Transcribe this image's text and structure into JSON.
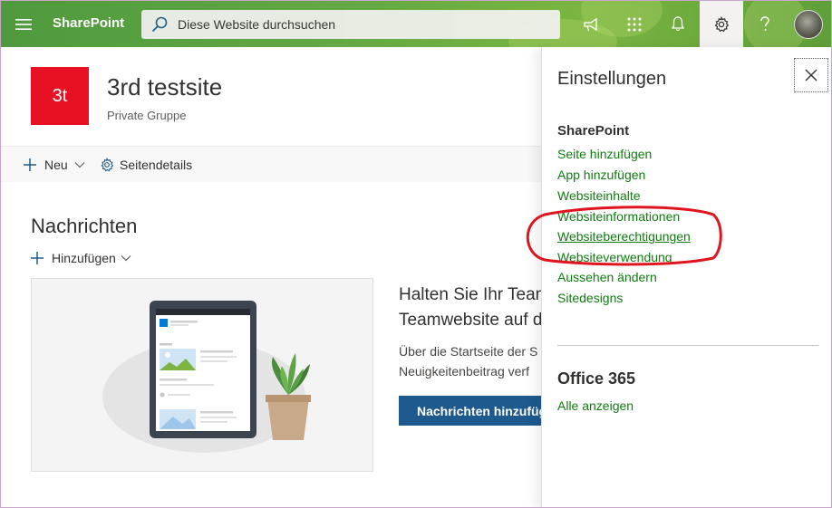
{
  "suitebar": {
    "brand": "SharePoint",
    "search_placeholder": "Diese Website durchsuchen",
    "icons": [
      "waffle-menu-icon",
      "megaphone-icon",
      "app-launcher-icon",
      "bell-icon",
      "gear-icon",
      "help-icon",
      "avatar"
    ]
  },
  "site": {
    "logo_text": "3t",
    "title": "3rd testsite",
    "subtitle": "Private Gruppe",
    "accent_color": "#e81123"
  },
  "commandbar": {
    "new_label": "Neu",
    "details_label": "Seitendetails"
  },
  "news": {
    "title": "Nachrichten",
    "add_label": "Hinzufügen",
    "promo_title_line1": "Halten Sie Ihr Team",
    "promo_title_line2": "Teamwebsite auf d",
    "promo_body_line1": "Über die Startseite der S",
    "promo_body_line2": "Neuigkeitenbeitrag verf",
    "promo_button": "Nachrichten hinzufüg"
  },
  "settings_panel": {
    "title": "Einstellungen",
    "sharepoint_heading": "SharePoint",
    "links": [
      {
        "label": "Seite hinzufügen"
      },
      {
        "label": "App hinzufügen"
      },
      {
        "label": "Websiteinhalte"
      },
      {
        "label": "Websiteinformationen"
      },
      {
        "label": "Websiteberechtigungen"
      },
      {
        "label": "Websiteverwendung"
      },
      {
        "label": "Aussehen ändern"
      },
      {
        "label": "Sitedesigns"
      }
    ],
    "office_heading": "Office 365",
    "office_link": "Alle anzeigen",
    "link_color": "#107c10"
  }
}
